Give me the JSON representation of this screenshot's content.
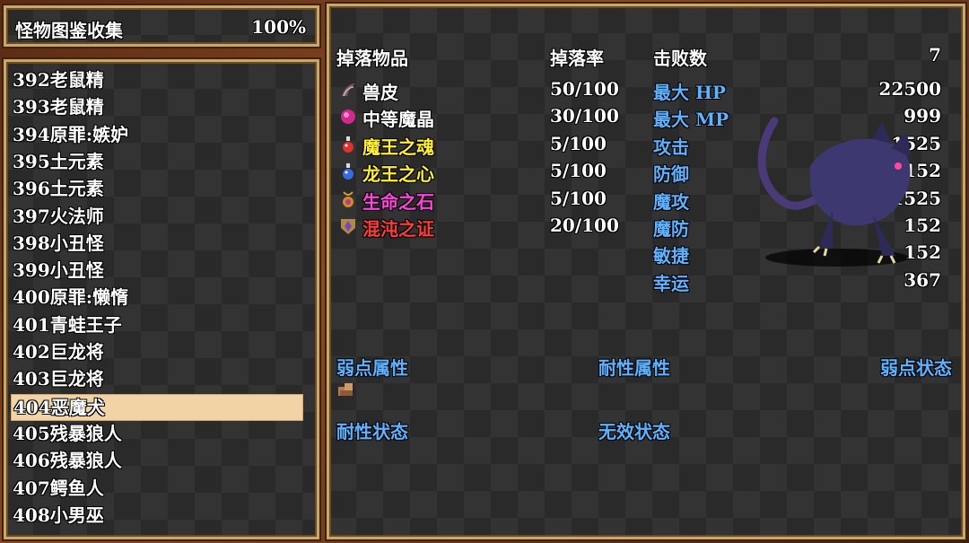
{
  "header": {
    "title": "怪物图鉴收集",
    "percent": "100%"
  },
  "list": {
    "items": [
      "392老鼠精",
      "393老鼠精",
      "394原罪:嫉妒",
      "395土元素",
      "396土元素",
      "397火法师",
      "398小丑怪",
      "399小丑怪",
      "400原罪:懒惰",
      "401青蛙王子",
      "402巨龙将",
      "403巨龙将",
      "404恶魔犬",
      "405残暴狼人",
      "406残暴狼人",
      "407鳄鱼人",
      "408小男巫"
    ],
    "selected_index": 12
  },
  "detail": {
    "drop_items_header": "掉落物品",
    "drop_rate_header": "掉落率",
    "kills_label": "击败数",
    "kills_value": "7",
    "drops": [
      {
        "name": "兽皮",
        "rate": "50/100",
        "icon": "claw-icon"
      },
      {
        "name": "中等魔晶",
        "rate": "30/100",
        "icon": "pink-gem-icon"
      },
      {
        "name": "魔王之魂",
        "rate": "5/100",
        "icon": "red-potion-icon"
      },
      {
        "name": "龙王之心",
        "rate": "5/100",
        "icon": "blue-potion-icon"
      },
      {
        "name": "生命之石",
        "rate": "5/100",
        "icon": "amulet-icon"
      },
      {
        "name": "混沌之证",
        "rate": "20/100",
        "icon": "emblem-icon"
      }
    ],
    "stats": [
      {
        "label": "最大 HP",
        "value": "22500"
      },
      {
        "label": "最大 MP",
        "value": "999"
      },
      {
        "label": "攻击",
        "value": "1525"
      },
      {
        "label": "防御",
        "value": "152"
      },
      {
        "label": "魔攻",
        "value": "1525"
      },
      {
        "label": "魔防",
        "value": "152"
      },
      {
        "label": "敏捷",
        "value": "152"
      },
      {
        "label": "幸运",
        "value": "367"
      }
    ],
    "weak_attr_label": "弱点属性",
    "resist_attr_label": "耐性属性",
    "weak_state_label": "弱点状态",
    "resist_state_label": "耐性状态",
    "immune_state_label": "无效状态",
    "weak_attr_icon": "earth-element-icon",
    "monster_image": "demon-hound-sprite"
  }
}
